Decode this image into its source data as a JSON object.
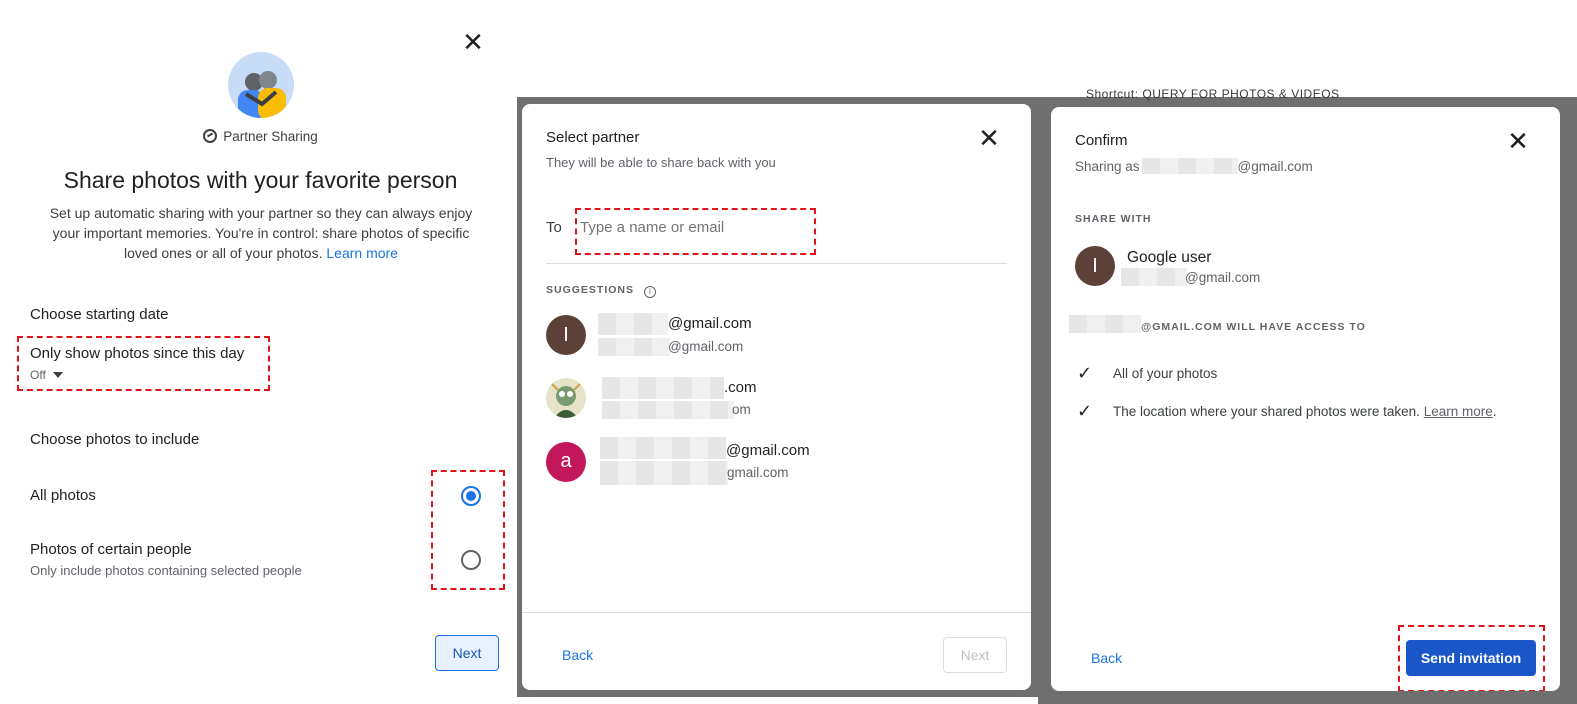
{
  "panel1": {
    "close_icon": "close-icon",
    "brand_label": "Partner Sharing",
    "title": "Share photos with your favorite person",
    "description": "Set up automatic sharing with your partner so they can always enjoy your important memories. You're in control: share photos of specific loved ones or all of your photos.",
    "learn_more": "Learn more",
    "date_section_title": "Choose starting date",
    "date_option_label": "Only show photos since this day",
    "date_option_value": "Off",
    "photos_section_title": "Choose photos to include",
    "option_all": "All photos",
    "option_people": "Photos of certain people",
    "option_people_sub": "Only include photos containing selected people",
    "next_button": "Next",
    "colors": {
      "accent": "#1a73e8",
      "highlight": "#e0121a"
    }
  },
  "panel2": {
    "backdrop_text": "Shortcut: QUERY FOR PHOTOS & VIDEOS",
    "title": "Select partner",
    "subtitle": "They will be able to share back with you",
    "to_label": "To",
    "input_placeholder": "Type a name or email",
    "suggestions_label": "SUGGESTIONS",
    "suggestions": [
      {
        "avatar": "I",
        "avatar_color": "#5d4037",
        "name_suffix": "@gmail.com",
        "email_suffix": "@gmail.com"
      },
      {
        "avatar": "",
        "avatar_color": "#9db99a",
        "name_suffix": ".com",
        "email_suffix": "om"
      },
      {
        "avatar": "a",
        "avatar_color": "#c2185b",
        "name_suffix": "@gmail.com",
        "email_suffix": "gmail.com"
      }
    ],
    "back_button": "Back",
    "next_button": "Next"
  },
  "panel3": {
    "title": "Confirm",
    "sharing_as_prefix": "Sharing as",
    "sharing_as_suffix": "@gmail.com",
    "share_with_label": "SHARE WITH",
    "recipient_avatar": "I",
    "recipient_name": "Google user",
    "recipient_email_suffix": "@gmail.com",
    "access_label_suffix": "@GMAIL.COM WILL HAVE ACCESS TO",
    "access_items": [
      "All of your photos",
      "The location where your shared photos were taken."
    ],
    "access_learn_more": "Learn more",
    "back_button": "Back",
    "send_button": "Send invitation"
  }
}
